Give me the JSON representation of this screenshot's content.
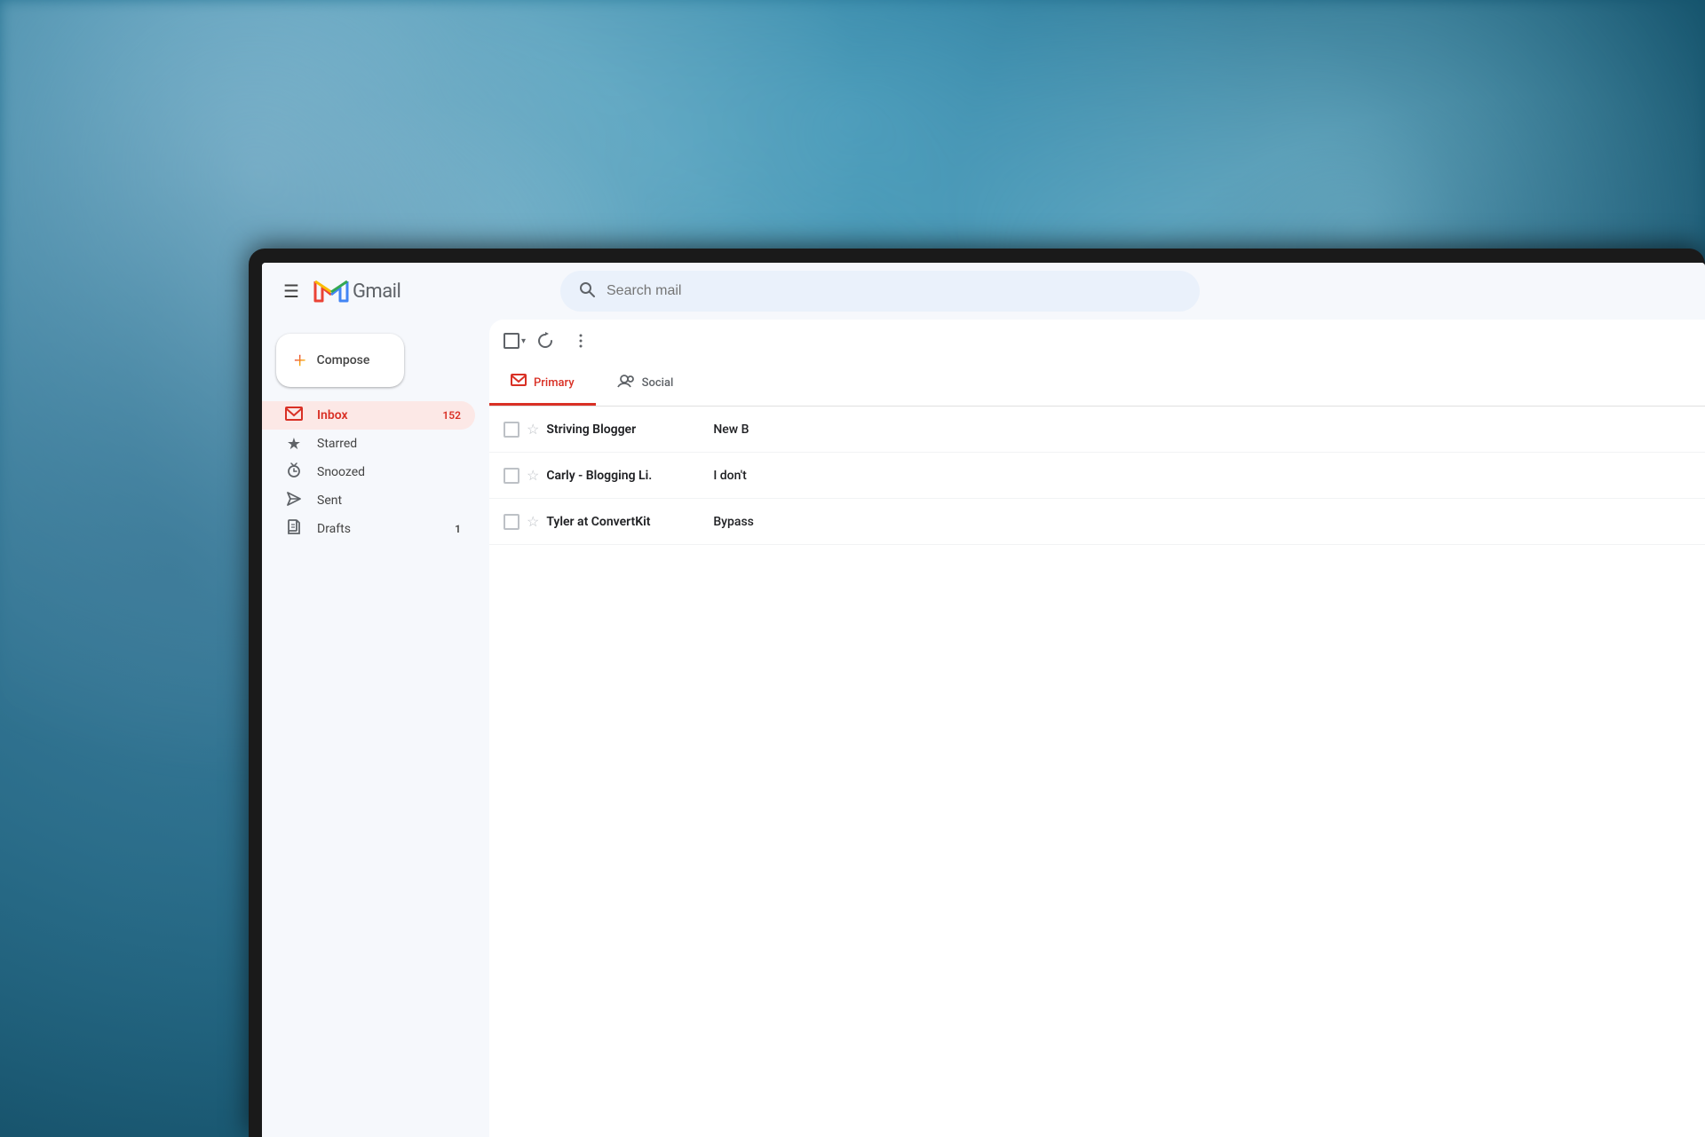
{
  "background": {
    "color_primary": "#3a8aaa",
    "color_secondary": "#1a5f7a"
  },
  "header": {
    "menu_icon": "☰",
    "app_name": "Gmail",
    "search_placeholder": "Search mail"
  },
  "compose": {
    "icon": "+",
    "label": "Compose"
  },
  "nav": {
    "items": [
      {
        "id": "inbox",
        "icon": "□",
        "label": "Inbox",
        "count": "152",
        "active": true
      },
      {
        "id": "starred",
        "icon": "★",
        "label": "Starred",
        "count": "",
        "active": false
      },
      {
        "id": "snoozed",
        "icon": "🕐",
        "label": "Snoozed",
        "count": "",
        "active": false
      },
      {
        "id": "sent",
        "icon": "▷",
        "label": "Sent",
        "count": "",
        "active": false
      },
      {
        "id": "drafts",
        "icon": "📄",
        "label": "Drafts",
        "count": "1",
        "active": false
      }
    ]
  },
  "toolbar": {
    "select_all_label": "Select",
    "refresh_label": "Refresh",
    "more_label": "More"
  },
  "tabs": [
    {
      "id": "primary",
      "icon": "□",
      "label": "Primary",
      "active": true
    },
    {
      "id": "social",
      "icon": "👥",
      "label": "Social",
      "active": false
    }
  ],
  "emails": [
    {
      "sender": "Striving Blogger",
      "preview": "New B",
      "starred": false,
      "unread": true
    },
    {
      "sender": "Carly - Blogging Li.",
      "preview": "I don't",
      "starred": false,
      "unread": true
    },
    {
      "sender": "Tyler at ConvertKit",
      "preview": "Bypass",
      "starred": false,
      "unread": true
    }
  ]
}
